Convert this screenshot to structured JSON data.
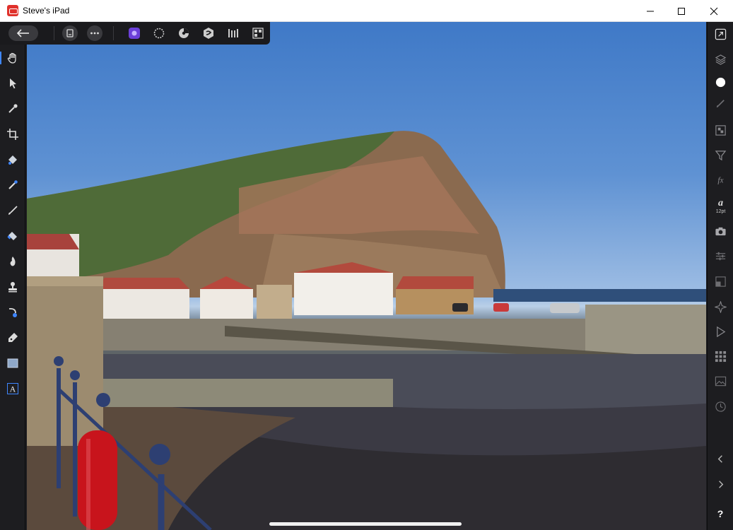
{
  "window": {
    "title": "Steve's iPad",
    "icon": "affinity-app-icon",
    "controls": [
      "minimize-icon",
      "maximize-icon",
      "close-icon"
    ]
  },
  "top_toolbar": {
    "items": [
      "back-arrow-icon",
      "document-icon",
      "more-icon",
      "photo-persona-icon",
      "liquify-persona-icon",
      "develop-persona-icon",
      "tone-mapping-persona-icon",
      "export-persona-icon",
      "mosaic-icon"
    ]
  },
  "left_toolbar": {
    "items": [
      "hand-icon",
      "pointer-icon",
      "eyedropper-icon",
      "crop-icon",
      "flood-fill-icon",
      "selection-brush-icon",
      "paint-brush-icon",
      "eraser-icon",
      "burn-icon",
      "clone-stamp-icon",
      "inpainting-icon",
      "pen-icon",
      "rectangle-shape-icon",
      "text-icon"
    ],
    "active": "hand-icon"
  },
  "right_toolbar": {
    "items": [
      "navigator-icon",
      "layers-icon",
      "color-icon",
      "brushes-icon",
      "adjustments-icon",
      "filters-icon",
      "fx-icon",
      "text-studio-icon",
      "camera-icon",
      "sliders-icon",
      "transform-icon",
      "crosshair-icon",
      "play-icon",
      "grid-icon",
      "image-icon",
      "history-icon",
      "chevron-left-icon",
      "chevron-right-icon",
      "help-icon"
    ],
    "text_size_label": "12pt",
    "help_label": "?"
  },
  "colors": {
    "accent": "#3f86ff",
    "persona_active": "#6b3fd9",
    "toolbar_bg": "#1d1d20",
    "titlebar_bg": "#ffffff"
  }
}
